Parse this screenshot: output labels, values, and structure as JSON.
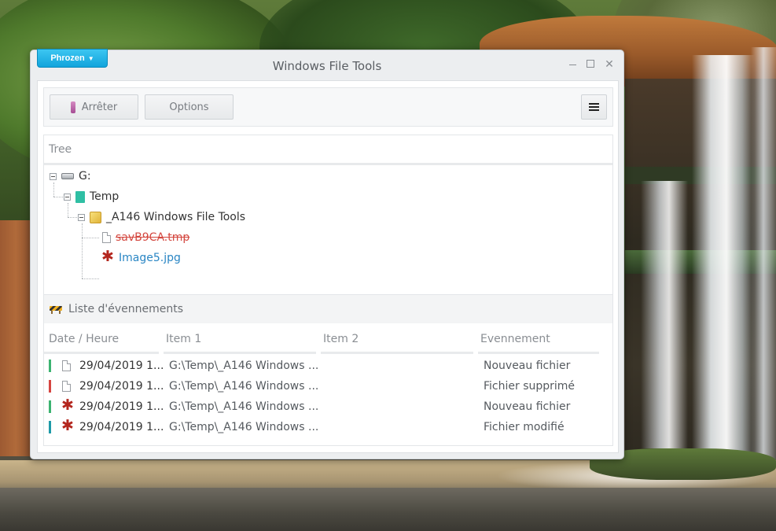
{
  "window": {
    "title": "Windows File Tools",
    "brand_menu": "Phrozen"
  },
  "toolbar": {
    "stop_label": "Arrêter",
    "options_label": "Options"
  },
  "tree": {
    "header": "Tree",
    "nodes": [
      {
        "label": "G:",
        "icon": "drive-icon",
        "state": "normal"
      },
      {
        "label": "Temp",
        "icon": "teal-folder-icon",
        "state": "normal"
      },
      {
        "label": "_A146 Windows File Tools",
        "icon": "yellow-folder-icon",
        "state": "normal"
      },
      {
        "label": "savB9CA.tmp",
        "icon": "file-icon",
        "state": "deleted"
      },
      {
        "label": "Image5.jpg",
        "icon": "image-file-icon",
        "state": "modified"
      }
    ]
  },
  "events": {
    "header": "Liste d'évennements",
    "columns": [
      "Date / Heure",
      "Item 1",
      "Item 2",
      "Evennement"
    ],
    "rows": [
      {
        "marker_color": "#3cb371",
        "icon": "file-icon",
        "date": "29/04/2019 1...",
        "item1": "G:\\Temp\\_A146 Windows ...",
        "item2": "",
        "event": "Nouveau fichier"
      },
      {
        "marker_color": "#d64541",
        "icon": "file-icon",
        "date": "29/04/2019 1...",
        "item1": "G:\\Temp\\_A146 Windows ...",
        "item2": "",
        "event": "Fichier supprimé"
      },
      {
        "marker_color": "#3cb371",
        "icon": "image-file-icon",
        "date": "29/04/2019 1...",
        "item1": "G:\\Temp\\_A146 Windows ...",
        "item2": "",
        "event": "Nouveau fichier"
      },
      {
        "marker_color": "#1e9aa8",
        "icon": "image-file-icon",
        "date": "29/04/2019 1...",
        "item1": "G:\\Temp\\_A146 Windows ...",
        "item2": "",
        "event": "Fichier modifié"
      }
    ]
  },
  "colors": {
    "brand": "#12a4dc",
    "deleted_text": "#d4473f",
    "modified_text": "#2a86c4"
  }
}
